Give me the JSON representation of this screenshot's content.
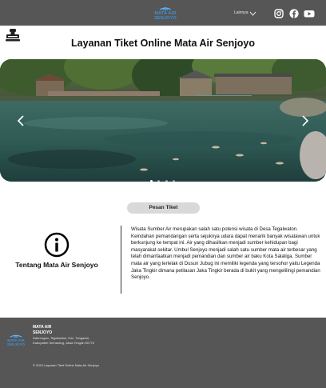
{
  "header": {
    "brand_line1": "MATA AIR",
    "brand_line2": "SENJOYO",
    "language_label": "Lainnya",
    "social_icons": [
      "instagram-icon",
      "facebook-icon",
      "youtube-icon"
    ]
  },
  "page": {
    "title": "Layanan Tiket Online Mata Air Senjoyo"
  },
  "carousel": {
    "slide_count": 4,
    "active_slide": 1
  },
  "order_button": {
    "label": "Pesan Tiket"
  },
  "about": {
    "title": "Tentang Mata Air Senjoyo",
    "body": "Wisata Sumber Air merupakan salah satu potensi wisata di Desa Tegalwaton. Keindahan pemandangan serta sejuknya udara dapat menarik banyak wisatawan untuk berkunjung ke tempat ini. Air yang dihasilkan menjadi sumber kehidupan bagi masyarakat sekitar. Umbul Senjoyo menjadi salah satu sumber mata air terbesar yang telah dimanfaatkan menjadi pemandian dan sumber air baku Kota Salatiga. Sumber mata air yang terletak di Dusun Jubug ini memiliki legenda yang tersohor yaitu Legenda Jaka Tingkir dimana petilasan Jaka Tingkir berada di bukit yang mengelilingi pemandian Senjoyo."
  },
  "footer": {
    "logo_line1": "MATA AIR",
    "logo_line2": "SENJOYO",
    "name_line1": "MATA AIR",
    "name_line2": "SENJOYO",
    "address": "Daborngan, Tegalwaton, Kec. Tengaran, Kabupaten Semarang, Jawa Tengah 50775",
    "copyright": "© 2024 Layanan Tiket Online Mata Air Senjoyo"
  },
  "colors": {
    "bar": "#565656",
    "brand_blue": "#3f8fd6",
    "button": "#d9d9d9"
  }
}
